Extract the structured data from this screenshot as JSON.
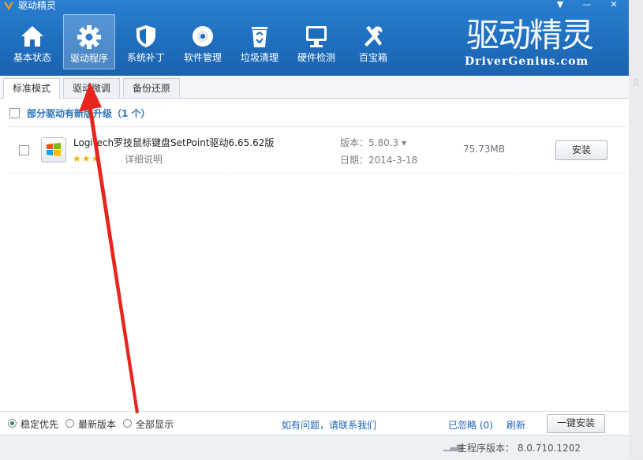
{
  "window": {
    "title": "驱动精灵"
  },
  "toolbar": {
    "items": [
      {
        "label": "基本状态",
        "icon": "house-icon"
      },
      {
        "label": "驱动程序",
        "icon": "gear-icon"
      },
      {
        "label": "系统补丁",
        "icon": "shield-icon"
      },
      {
        "label": "软件管理",
        "icon": "disc-icon"
      },
      {
        "label": "垃圾清理",
        "icon": "recycle-bin-icon"
      },
      {
        "label": "硬件检测",
        "icon": "monitor-icon"
      },
      {
        "label": "百宝箱",
        "icon": "tools-icon"
      }
    ],
    "active_index": 1
  },
  "brand": {
    "cn": "驱动精灵",
    "en": "DriverGenius.com"
  },
  "tabs": [
    {
      "label": "标准模式"
    },
    {
      "label": "驱动微调"
    },
    {
      "label": "备份还原"
    }
  ],
  "section": {
    "title": "部分驱动有新版升级（1 个）"
  },
  "drivers": [
    {
      "name": "Logitech罗技鼠标键盘SetPoint驱动6.65.62版",
      "stars": "★★★",
      "detail": "详细说明",
      "version": "版本：5.80.3 ▾",
      "date": "日期：2014-3-18",
      "size": "75.73MB",
      "install": "安装"
    }
  ],
  "footer": {
    "radio_options": [
      "稳定优先",
      "最新版本",
      "全部显示"
    ],
    "selected_radio": 0,
    "contact": "如有问题，请联系我们",
    "ignored": "已忽略 (0)",
    "refresh": "刷新",
    "reinstall": "一键安装"
  },
  "statusbar": {
    "version": "主程序版本： 8.0.710.1202"
  },
  "colors": {
    "header": "#1f6dbd",
    "accent_link": "#1d63b5",
    "annotation_arrow": "#e8251d"
  }
}
